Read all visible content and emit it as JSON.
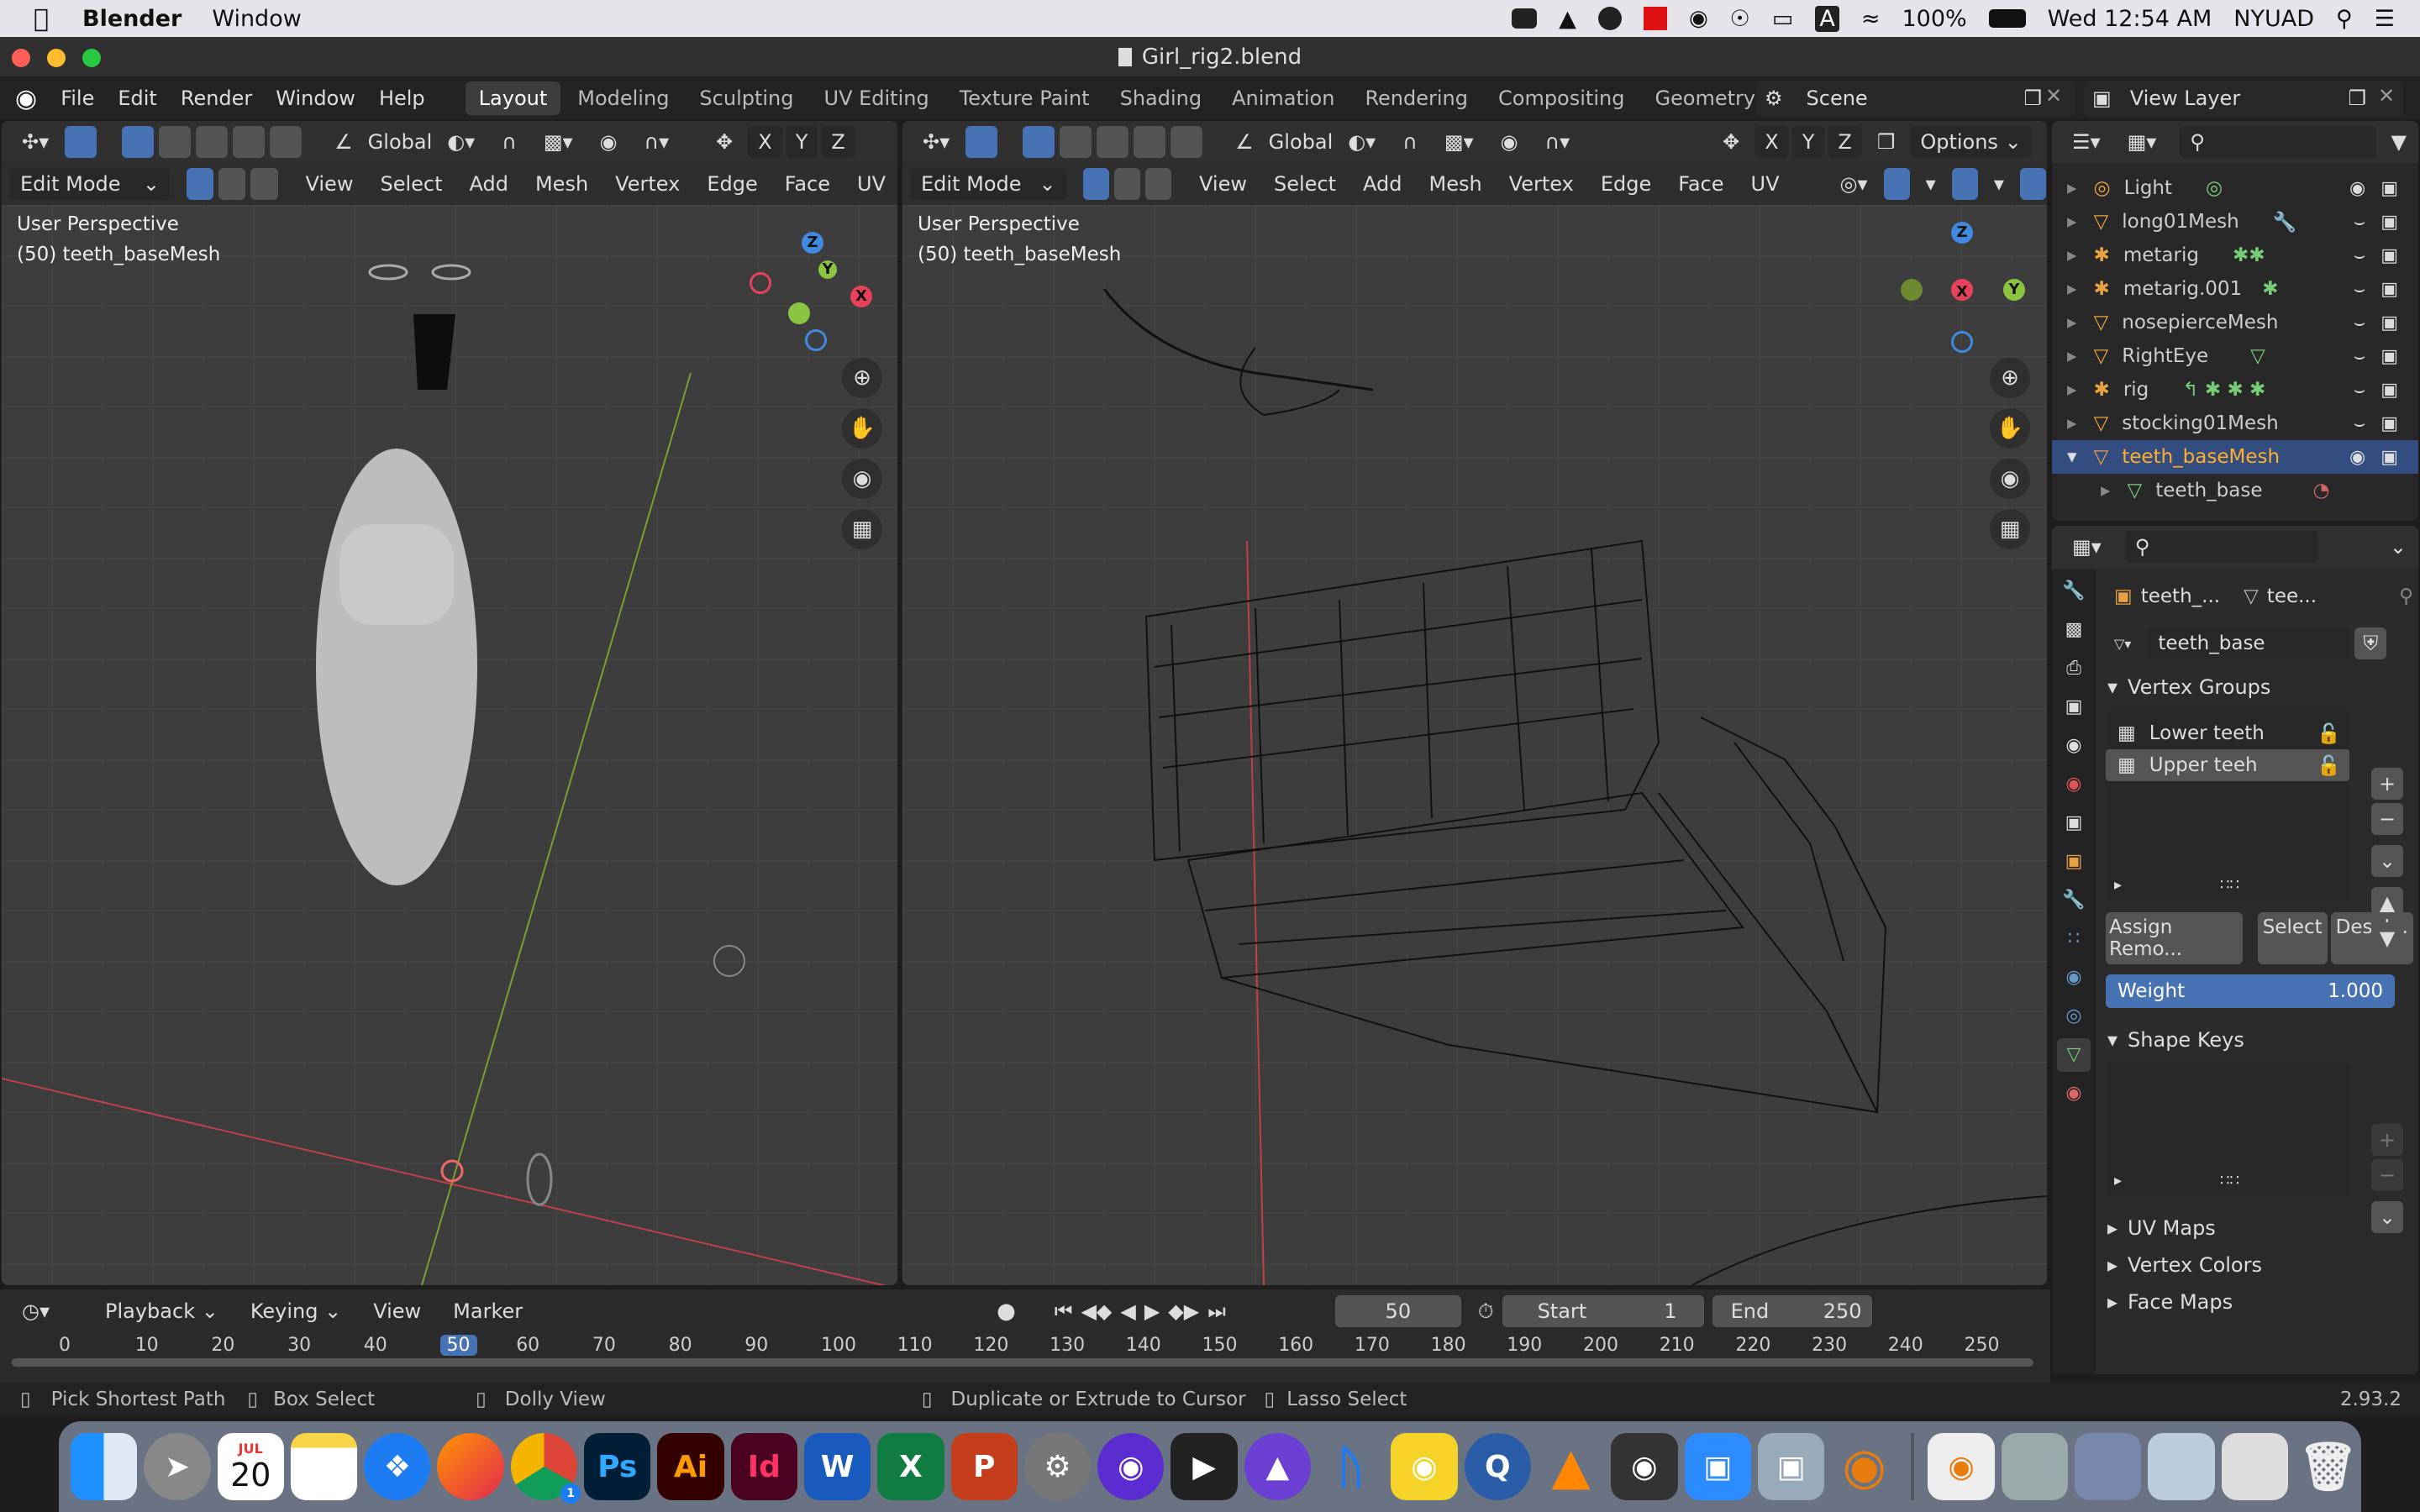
{
  "macos": {
    "app_name": "Blender",
    "menu": [
      "Window"
    ],
    "clock": "Wed 12:54 AM",
    "battery": "100%",
    "user": "NYUAD",
    "input_letter": "A"
  },
  "window": {
    "title": "Girl_rig2.blend"
  },
  "blender_menu": [
    "File",
    "Edit",
    "Render",
    "Window",
    "Help"
  ],
  "workspaces": [
    "Layout",
    "Modeling",
    "Sculpting",
    "UV Editing",
    "Texture Paint",
    "Shading",
    "Animation",
    "Rendering",
    "Compositing",
    "Geometry Nodes",
    "S"
  ],
  "active_workspace": "Layout",
  "scene": {
    "label": "Scene"
  },
  "view_layer": {
    "label": "View Layer"
  },
  "left_viewport": {
    "orientation": "Global",
    "mode": "Edit Mode",
    "menus": [
      "View",
      "Select",
      "Add",
      "Mesh",
      "Vertex",
      "Edge",
      "Face",
      "UV"
    ],
    "overlay_line1": "User Perspective",
    "overlay_line2": "(50) teeth_baseMesh",
    "axis": {
      "x": "X",
      "y": "Y",
      "z": "Z"
    }
  },
  "right_viewport": {
    "orientation": "Global",
    "mode": "Edit Mode",
    "options_label": "Options",
    "menus": [
      "View",
      "Select",
      "Add",
      "Mesh",
      "Vertex",
      "Edge",
      "Face",
      "UV"
    ],
    "overlay_line1": "User Perspective",
    "overlay_line2": "(50) teeth_baseMesh",
    "axis": {
      "x": "X",
      "y": "Y",
      "z": "Z"
    },
    "mirror_axes": [
      "X",
      "Y",
      "Z"
    ]
  },
  "outliner": {
    "items": [
      {
        "name": "Light",
        "type": "light"
      },
      {
        "name": "long01Mesh",
        "type": "mesh"
      },
      {
        "name": "metarig",
        "type": "armature"
      },
      {
        "name": "metarig.001",
        "type": "armature"
      },
      {
        "name": "nosepierceMesh",
        "type": "mesh"
      },
      {
        "name": "RightEye",
        "type": "mesh"
      },
      {
        "name": "rig",
        "type": "armature"
      },
      {
        "name": "stocking01Mesh",
        "type": "mesh"
      },
      {
        "name": "teeth_baseMesh",
        "type": "mesh",
        "selected": true
      },
      {
        "name": "teeth_base",
        "type": "mesh-data",
        "child": true
      }
    ]
  },
  "properties": {
    "object_name": "teeth_...",
    "data_name": "tee...",
    "mesh_data_name": "teeth_base",
    "vertex_groups_label": "Vertex Groups",
    "vertex_groups": [
      "Lower teeth",
      "Upper teeh"
    ],
    "selected_group": "Upper teeh",
    "assign_label": "Assign",
    "remove_label": "Remo...",
    "select_label": "Select",
    "deselect_label": "Desel...",
    "weight_label": "Weight",
    "weight_value": "1.000",
    "shape_keys_label": "Shape Keys",
    "uv_maps_label": "UV Maps",
    "vertex_colors_label": "Vertex Colors",
    "face_maps_label": "Face Maps"
  },
  "timeline": {
    "menus": [
      "Playback",
      "Keying",
      "View",
      "Marker"
    ],
    "current_frame": "50",
    "start_label": "Start",
    "start": "1",
    "end_label": "End",
    "end": "250",
    "ticks": [
      "0",
      "10",
      "20",
      "30",
      "40",
      "50",
      "60",
      "70",
      "80",
      "90",
      "100",
      "110",
      "120",
      "130",
      "140",
      "150",
      "160",
      "170",
      "180",
      "190",
      "200",
      "210",
      "220",
      "230",
      "240",
      "250"
    ]
  },
  "status_bar": {
    "hint1": "Pick Shortest Path",
    "hint2": "Box Select",
    "hint3": "Dolly View",
    "hint4": "Duplicate or Extrude to Cursor",
    "hint5": "Lasso Select",
    "version": "2.93.2"
  },
  "dock": {
    "calendar_month": "JUL",
    "calendar_day": "20",
    "badge": "1",
    "apps": [
      "finder-icon",
      "launchpad-icon",
      "calendar-icon",
      "notes-icon",
      "safari-icon",
      "firefox-icon",
      "chrome-icon",
      "photoshop-icon",
      "illustrator-icon",
      "indesign-icon",
      "word-icon",
      "excel-icon",
      "powerpoint-icon",
      "system-preferences-icon",
      "screen-app-icon",
      "final-cut-icon",
      "affinity-icon",
      "bluetooth-icon",
      "cyberduck-icon",
      "quicktime-icon",
      "vlc-icon",
      "disk-utility-icon",
      "zoom-icon",
      "preview-icon",
      "blender-icon"
    ],
    "ps": "Ps",
    "ai": "Ai",
    "id": "Id"
  },
  "colors": {
    "accent": "#4772b3",
    "selected_row": "#334d80",
    "x_axis": "#e8425a",
    "y_axis": "#8bc43f",
    "z_axis": "#3f8ae0"
  }
}
